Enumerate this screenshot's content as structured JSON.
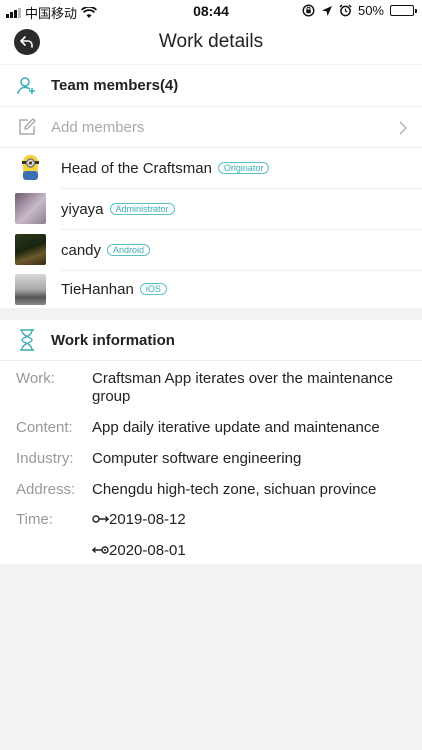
{
  "status_bar": {
    "carrier": "中国移动",
    "time": "08:44",
    "battery": "50%",
    "battery_level": 0.5
  },
  "nav": {
    "title": "Work details",
    "back_icon": "back-arrow-icon"
  },
  "team": {
    "header": "Team members(4)",
    "add_label": "Add members",
    "members": [
      {
        "name": "Head of the Craftsman",
        "role": "Originator"
      },
      {
        "name": "yiyaya",
        "role": "Administrator"
      },
      {
        "name": "candy",
        "role": "Android"
      },
      {
        "name": "TieHanhan",
        "role": "iOS"
      }
    ]
  },
  "work": {
    "header": "Work information",
    "rows": {
      "work_key": "Work:",
      "work_val": "Craftsman App iterates over the maintenance group",
      "content_key": "Content:",
      "content_val": "App daily iterative update and maintenance",
      "industry_key": "Industry:",
      "industry_val": "Computer software engineering",
      "address_key": "Address:",
      "address_val": "Chengdu high-tech zone, sichuan province",
      "time_key": "Time:",
      "start_date": "2019-08-12",
      "end_date": "2020-08-01"
    }
  },
  "colors": {
    "accent": "#3aaeb4",
    "badge_border": "#5cc0c6",
    "battery": "#f5c400"
  }
}
